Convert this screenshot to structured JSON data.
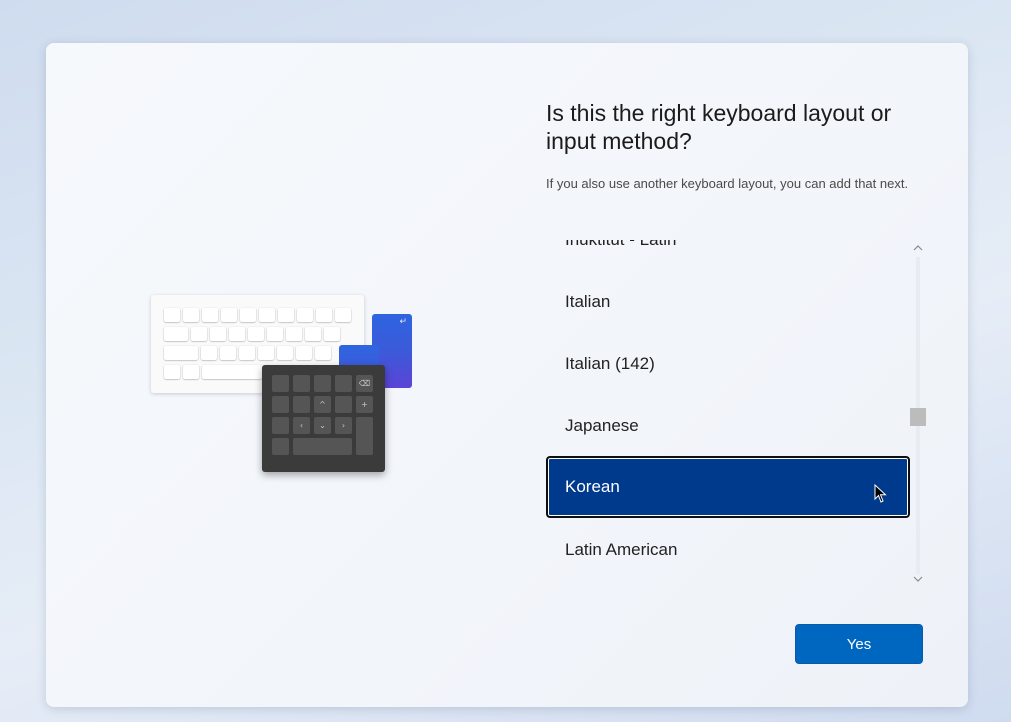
{
  "dialog": {
    "title": "Is this the right keyboard layout or input method?",
    "subtitle": "If you also use another keyboard layout, you can add that next."
  },
  "layout_list": {
    "items": [
      {
        "label": "Inuktitut - Latin",
        "selected": false
      },
      {
        "label": "Italian",
        "selected": false
      },
      {
        "label": "Italian (142)",
        "selected": false
      },
      {
        "label": "Japanese",
        "selected": false
      },
      {
        "label": "Korean",
        "selected": true
      },
      {
        "label": "Latin American",
        "selected": false
      }
    ]
  },
  "buttons": {
    "yes_label": "Yes"
  },
  "icons": {
    "scroll_up": "chevron-up-icon",
    "scroll_down": "chevron-down-icon",
    "pointer": "mouse-pointer-icon"
  },
  "colors": {
    "accent": "#0067c0",
    "selected_bg": "#003a8c"
  }
}
